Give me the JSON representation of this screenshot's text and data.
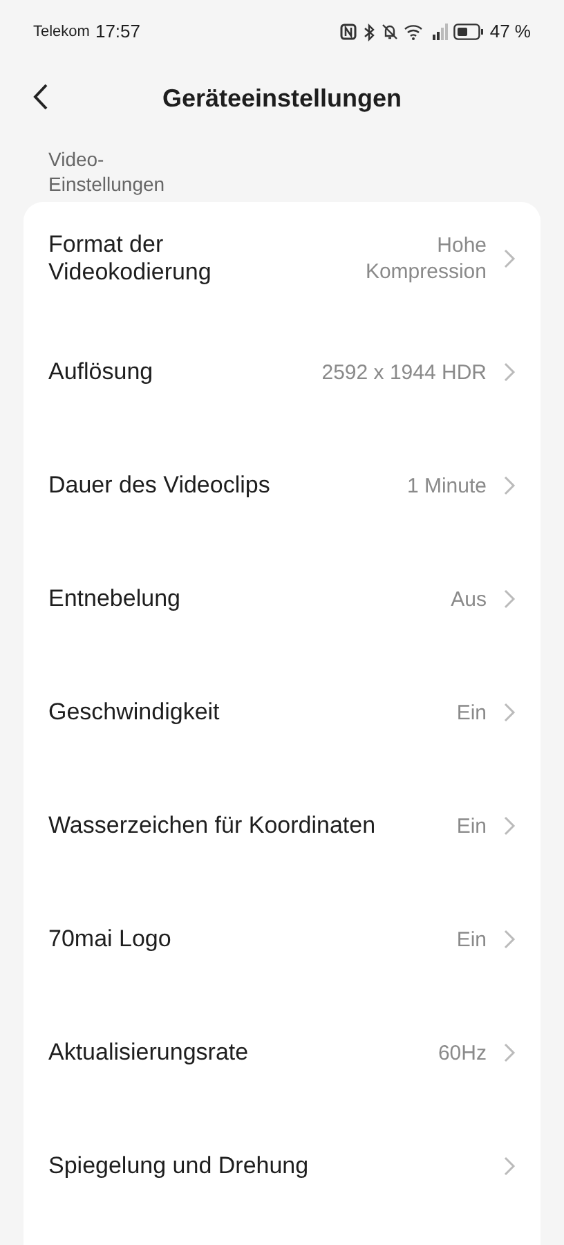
{
  "status_bar": {
    "carrier": "Telekom",
    "time": "17:57",
    "battery": "47 %"
  },
  "header": {
    "title": "Geräteeinstellungen"
  },
  "section": {
    "title": "Video-\nEinstellungen"
  },
  "settings": [
    {
      "label": "Format der Videokodierung",
      "value": "Hohe Kompression"
    },
    {
      "label": "Auflösung",
      "value": "2592 x 1944 HDR"
    },
    {
      "label": "Dauer des Videoclips",
      "value": "1 Minute"
    },
    {
      "label": "Entnebelung",
      "value": "Aus"
    },
    {
      "label": "Geschwindigkeit",
      "value": "Ein"
    },
    {
      "label": "Wasserzeichen für Koordinaten",
      "value": "Ein"
    },
    {
      "label": "70mai Logo",
      "value": "Ein"
    },
    {
      "label": "Aktualisierungsrate",
      "value": "60Hz"
    },
    {
      "label": "Spiegelung und Drehung"
    }
  ]
}
